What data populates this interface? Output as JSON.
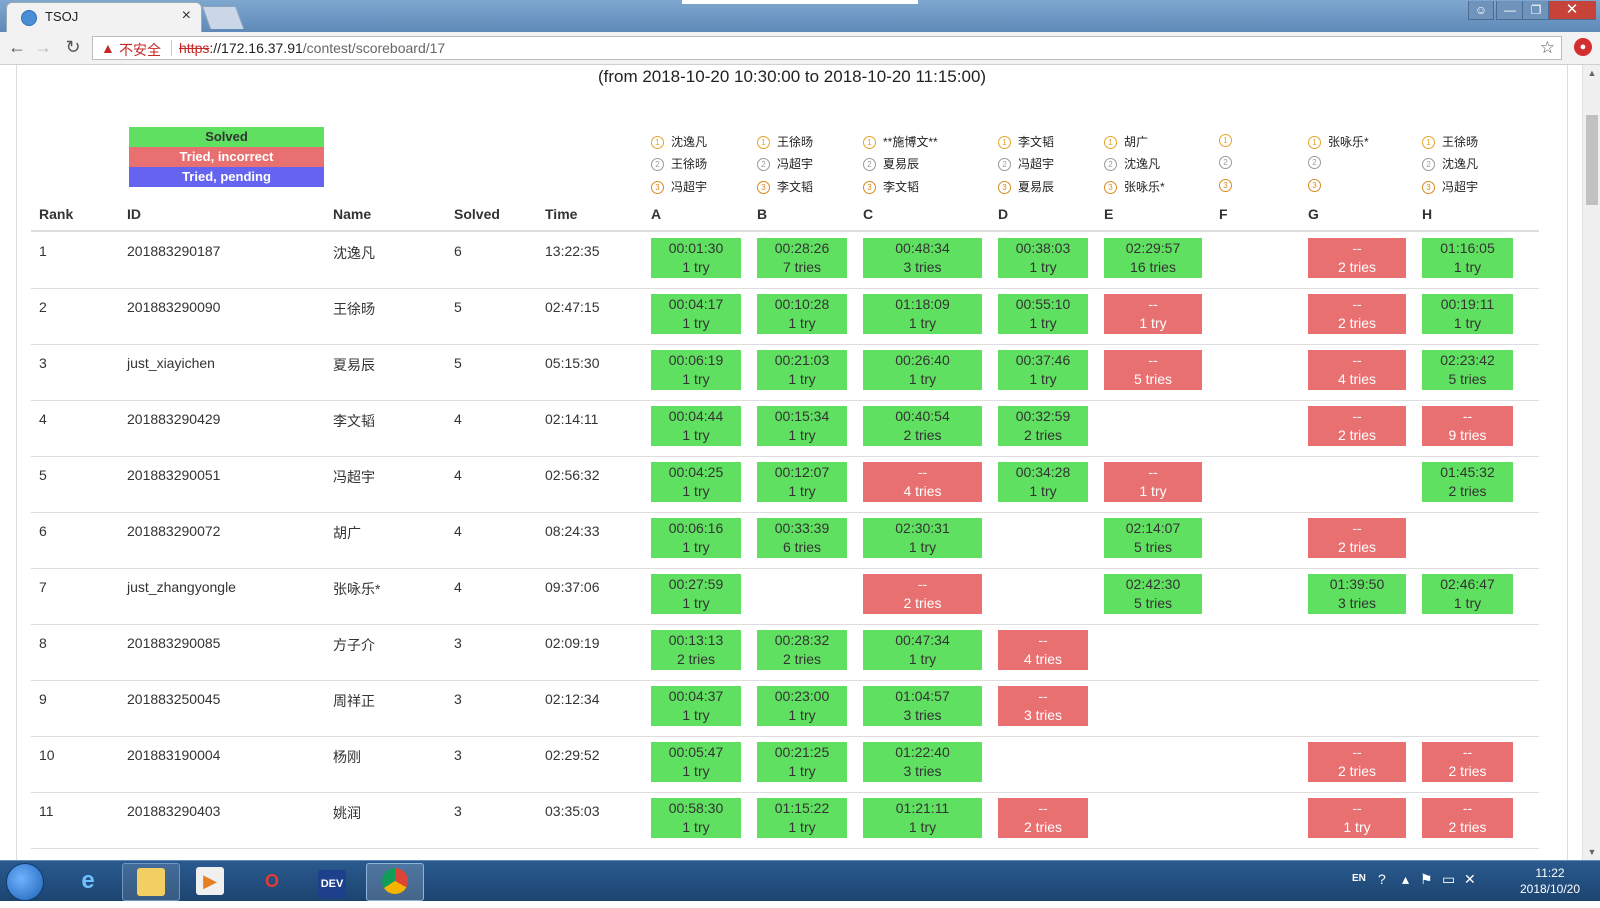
{
  "browser": {
    "tab_title": "TSOJ",
    "tab_close": "×",
    "insecure_label": "不安全",
    "url_scheme": "https",
    "url_host": "://172.16.37.91",
    "url_path": "/contest/scoreboard/17",
    "window_buttons": {
      "user": "☺",
      "minimize": "—",
      "maximize": "❐",
      "close": "✕"
    },
    "nav": {
      "back": "←",
      "forward": "→",
      "reload": "↻",
      "star": "☆"
    }
  },
  "scoreboard": {
    "time_range": "(from 2018-10-20 10:30:00 to 2018-10-20 11:15:00)",
    "legend": {
      "solved": "Solved",
      "incorrect": "Tried, incorrect",
      "pending": "Tried, pending"
    },
    "headers": {
      "rank": "Rank",
      "id": "ID",
      "name": "Name",
      "solved": "Solved",
      "time": "Time"
    },
    "medal_marks": [
      "1",
      "2",
      "3"
    ],
    "problems": [
      {
        "label": "A",
        "first": [
          "沈逸凡",
          "王徐旸",
          "冯超宇"
        ]
      },
      {
        "label": "B",
        "first": [
          "王徐旸",
          "冯超宇",
          "李文韬"
        ]
      },
      {
        "label": "C",
        "first": [
          "**施博文**",
          "夏易辰",
          "李文韬"
        ]
      },
      {
        "label": "D",
        "first": [
          "李文韬",
          "冯超宇",
          "夏易辰"
        ]
      },
      {
        "label": "E",
        "first": [
          "胡广",
          "沈逸凡",
          "张咏乐*"
        ]
      },
      {
        "label": "F",
        "first": [
          "",
          "",
          ""
        ]
      },
      {
        "label": "G",
        "first": [
          "张咏乐*",
          "",
          ""
        ]
      },
      {
        "label": "H",
        "first": [
          "王徐旸",
          "沈逸凡",
          "冯超宇"
        ]
      }
    ],
    "rows": [
      {
        "rank": "1",
        "id": "201883290187",
        "name": "沈逸凡",
        "solved": "6",
        "time": "13:22:35",
        "cells": [
          {
            "status": "solved",
            "time": "00:01:30",
            "tries": "1 try"
          },
          {
            "status": "solved",
            "time": "00:28:26",
            "tries": "7 tries"
          },
          {
            "status": "solved",
            "time": "00:48:34",
            "tries": "3 tries"
          },
          {
            "status": "solved",
            "time": "00:38:03",
            "tries": "1 try"
          },
          {
            "status": "solved",
            "time": "02:29:57",
            "tries": "16 tries"
          },
          null,
          {
            "status": "incorrect",
            "time": "--",
            "tries": "2 tries"
          },
          {
            "status": "solved",
            "time": "01:16:05",
            "tries": "1 try"
          }
        ]
      },
      {
        "rank": "2",
        "id": "201883290090",
        "name": "王徐旸",
        "solved": "5",
        "time": "02:47:15",
        "cells": [
          {
            "status": "solved",
            "time": "00:04:17",
            "tries": "1 try"
          },
          {
            "status": "solved",
            "time": "00:10:28",
            "tries": "1 try"
          },
          {
            "status": "solved",
            "time": "01:18:09",
            "tries": "1 try"
          },
          {
            "status": "solved",
            "time": "00:55:10",
            "tries": "1 try"
          },
          {
            "status": "incorrect",
            "time": "--",
            "tries": "1 try"
          },
          null,
          {
            "status": "incorrect",
            "time": "--",
            "tries": "2 tries"
          },
          {
            "status": "solved",
            "time": "00:19:11",
            "tries": "1 try"
          }
        ]
      },
      {
        "rank": "3",
        "id": "just_xiayichen",
        "name": "夏易辰",
        "solved": "5",
        "time": "05:15:30",
        "cells": [
          {
            "status": "solved",
            "time": "00:06:19",
            "tries": "1 try"
          },
          {
            "status": "solved",
            "time": "00:21:03",
            "tries": "1 try"
          },
          {
            "status": "solved",
            "time": "00:26:40",
            "tries": "1 try"
          },
          {
            "status": "solved",
            "time": "00:37:46",
            "tries": "1 try"
          },
          {
            "status": "incorrect",
            "time": "--",
            "tries": "5 tries"
          },
          null,
          {
            "status": "incorrect",
            "time": "--",
            "tries": "4 tries"
          },
          {
            "status": "solved",
            "time": "02:23:42",
            "tries": "5 tries"
          }
        ]
      },
      {
        "rank": "4",
        "id": "201883290429",
        "name": "李文韬",
        "solved": "4",
        "time": "02:14:11",
        "cells": [
          {
            "status": "solved",
            "time": "00:04:44",
            "tries": "1 try"
          },
          {
            "status": "solved",
            "time": "00:15:34",
            "tries": "1 try"
          },
          {
            "status": "solved",
            "time": "00:40:54",
            "tries": "2 tries"
          },
          {
            "status": "solved",
            "time": "00:32:59",
            "tries": "2 tries"
          },
          null,
          null,
          {
            "status": "incorrect",
            "time": "--",
            "tries": "2 tries"
          },
          {
            "status": "incorrect",
            "time": "--",
            "tries": "9 tries"
          }
        ]
      },
      {
        "rank": "5",
        "id": "201883290051",
        "name": "冯超宇",
        "solved": "4",
        "time": "02:56:32",
        "cells": [
          {
            "status": "solved",
            "time": "00:04:25",
            "tries": "1 try"
          },
          {
            "status": "solved",
            "time": "00:12:07",
            "tries": "1 try"
          },
          {
            "status": "incorrect",
            "time": "--",
            "tries": "4 tries"
          },
          {
            "status": "solved",
            "time": "00:34:28",
            "tries": "1 try"
          },
          {
            "status": "incorrect",
            "time": "--",
            "tries": "1 try"
          },
          null,
          null,
          {
            "status": "solved",
            "time": "01:45:32",
            "tries": "2 tries"
          }
        ]
      },
      {
        "rank": "6",
        "id": "201883290072",
        "name": "胡广",
        "solved": "4",
        "time": "08:24:33",
        "cells": [
          {
            "status": "solved",
            "time": "00:06:16",
            "tries": "1 try"
          },
          {
            "status": "solved",
            "time": "00:33:39",
            "tries": "6 tries"
          },
          {
            "status": "solved",
            "time": "02:30:31",
            "tries": "1 try"
          },
          null,
          {
            "status": "solved",
            "time": "02:14:07",
            "tries": "5 tries"
          },
          null,
          {
            "status": "incorrect",
            "time": "--",
            "tries": "2 tries"
          },
          null
        ]
      },
      {
        "rank": "7",
        "id": "just_zhangyongle",
        "name": "张咏乐*",
        "solved": "4",
        "time": "09:37:06",
        "cells": [
          {
            "status": "solved",
            "time": "00:27:59",
            "tries": "1 try"
          },
          null,
          {
            "status": "incorrect",
            "time": "--",
            "tries": "2 tries"
          },
          null,
          {
            "status": "solved",
            "time": "02:42:30",
            "tries": "5 tries"
          },
          null,
          {
            "status": "solved",
            "time": "01:39:50",
            "tries": "3 tries"
          },
          {
            "status": "solved",
            "time": "02:46:47",
            "tries": "1 try"
          }
        ]
      },
      {
        "rank": "8",
        "id": "201883290085",
        "name": "方子介",
        "solved": "3",
        "time": "02:09:19",
        "cells": [
          {
            "status": "solved",
            "time": "00:13:13",
            "tries": "2 tries"
          },
          {
            "status": "solved",
            "time": "00:28:32",
            "tries": "2 tries"
          },
          {
            "status": "solved",
            "time": "00:47:34",
            "tries": "1 try"
          },
          {
            "status": "incorrect",
            "time": "--",
            "tries": "4 tries"
          },
          null,
          null,
          null,
          null
        ]
      },
      {
        "rank": "9",
        "id": "201883250045",
        "name": "周祥正",
        "solved": "3",
        "time": "02:12:34",
        "cells": [
          {
            "status": "solved",
            "time": "00:04:37",
            "tries": "1 try"
          },
          {
            "status": "solved",
            "time": "00:23:00",
            "tries": "1 try"
          },
          {
            "status": "solved",
            "time": "01:04:57",
            "tries": "3 tries"
          },
          {
            "status": "incorrect",
            "time": "--",
            "tries": "3 tries"
          },
          null,
          null,
          null,
          null
        ]
      },
      {
        "rank": "10",
        "id": "201883190004",
        "name": "杨刚",
        "solved": "3",
        "time": "02:29:52",
        "cells": [
          {
            "status": "solved",
            "time": "00:05:47",
            "tries": "1 try"
          },
          {
            "status": "solved",
            "time": "00:21:25",
            "tries": "1 try"
          },
          {
            "status": "solved",
            "time": "01:22:40",
            "tries": "3 tries"
          },
          null,
          null,
          null,
          {
            "status": "incorrect",
            "time": "--",
            "tries": "2 tries"
          },
          {
            "status": "incorrect",
            "time": "--",
            "tries": "2 tries"
          }
        ]
      },
      {
        "rank": "11",
        "id": "201883290403",
        "name": "姚润",
        "solved": "3",
        "time": "03:35:03",
        "cells": [
          {
            "status": "solved",
            "time": "00:58:30",
            "tries": "1 try"
          },
          {
            "status": "solved",
            "time": "01:15:22",
            "tries": "1 try"
          },
          {
            "status": "solved",
            "time": "01:21:11",
            "tries": "1 try"
          },
          {
            "status": "incorrect",
            "time": "--",
            "tries": "2 tries"
          },
          null,
          null,
          {
            "status": "incorrect",
            "time": "--",
            "tries": "1 try"
          },
          {
            "status": "incorrect",
            "time": "--",
            "tries": "2 tries"
          }
        ]
      }
    ]
  },
  "colors": {
    "solved": "#60e060",
    "incorrect": "#e87070",
    "pending": "#6464f0"
  },
  "taskbar": {
    "apps": [
      "ie-icon",
      "folder-icon",
      "media-player-icon",
      "opera-icon",
      "dev-cpp-icon",
      "chrome-icon"
    ],
    "dev_label": "DEV",
    "opera_label": "O",
    "lang": "EN",
    "time": "11:22",
    "date": "2018/10/20"
  }
}
